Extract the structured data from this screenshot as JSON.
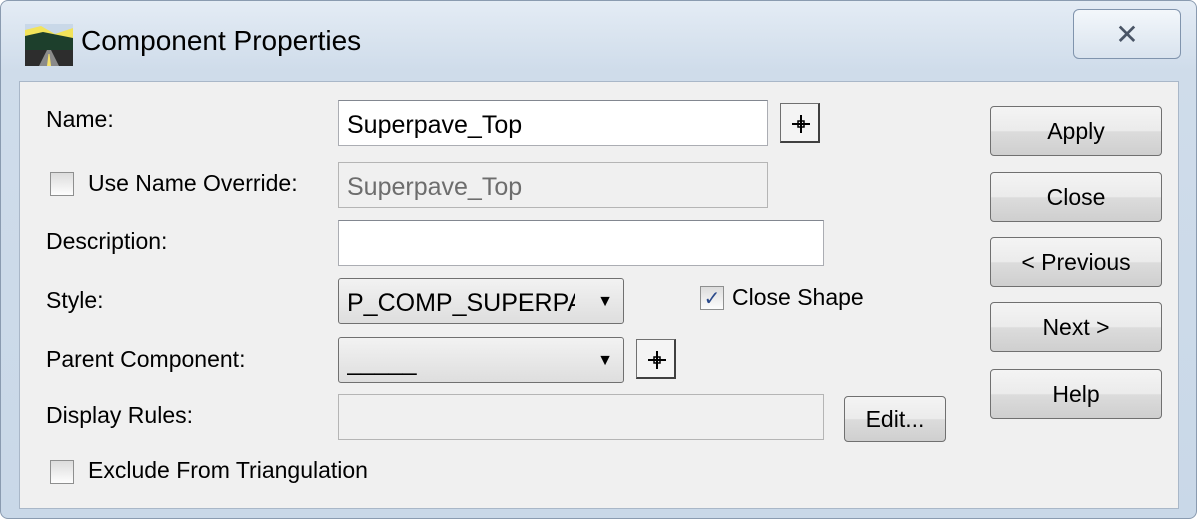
{
  "window": {
    "title": "Component Properties",
    "close_glyph": "✕",
    "icon": "road-app-icon"
  },
  "fields": {
    "name": {
      "label": "Name:",
      "value": "Superpave_Top"
    },
    "name_override": {
      "label": "Use Name Override:",
      "checked": false,
      "value": "Superpave_Top"
    },
    "description": {
      "label": "Description:",
      "value": ""
    },
    "style": {
      "label": "Style:",
      "value": "P_COMP_SUPERPA"
    },
    "close_shape": {
      "label": "Close Shape",
      "checked": true,
      "check_glyph": "✓"
    },
    "parent_component": {
      "label": "Parent Component:",
      "value": "_____"
    },
    "display_rules": {
      "label": "Display Rules:",
      "value": "",
      "edit_label": "Edit..."
    },
    "exclude_triangulation": {
      "label": "Exclude From Triangulation",
      "checked": false
    }
  },
  "buttons": {
    "apply": "Apply",
    "close": "Close",
    "previous": "< Previous",
    "next": "Next >",
    "help": "Help"
  },
  "colors": {
    "accent": "#2b4a8b",
    "window_border": "#8a9bb0",
    "client_bg": "#f0f0f0"
  }
}
